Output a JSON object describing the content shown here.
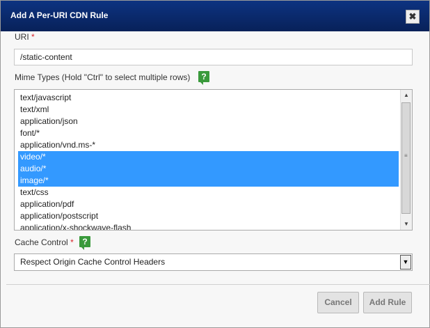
{
  "dialog": {
    "title": "Add A Per-URI CDN Rule",
    "close_glyph": "✖"
  },
  "uri": {
    "label": "URI",
    "required_mark": "*",
    "value": "/static-content"
  },
  "mime_types": {
    "label": "Mime Types (Hold \"Ctrl\" to select multiple rows)",
    "help_glyph": "?",
    "items": [
      {
        "label": "text/javascript",
        "selected": false
      },
      {
        "label": "text/xml",
        "selected": false
      },
      {
        "label": "application/json",
        "selected": false
      },
      {
        "label": "font/*",
        "selected": false
      },
      {
        "label": "application/vnd.ms-*",
        "selected": false
      },
      {
        "label": "video/*",
        "selected": true
      },
      {
        "label": "audio/*",
        "selected": true
      },
      {
        "label": "image/*",
        "selected": true
      },
      {
        "label": "text/css",
        "selected": false
      },
      {
        "label": "application/pdf",
        "selected": false
      },
      {
        "label": "application/postscript",
        "selected": false
      },
      {
        "label": "application/x-shockwave-flash",
        "selected": false
      }
    ]
  },
  "cache_control": {
    "label": "Cache Control",
    "required_mark": "*",
    "help_glyph": "?",
    "selected": "Respect Origin Cache Control Headers"
  },
  "buttons": {
    "cancel": "Cancel",
    "add_rule": "Add Rule"
  },
  "colors": {
    "titlebar": "#0a2a6b",
    "selection": "#3399ff",
    "help_icon": "#3a9a3c",
    "required": "#d9242a"
  }
}
